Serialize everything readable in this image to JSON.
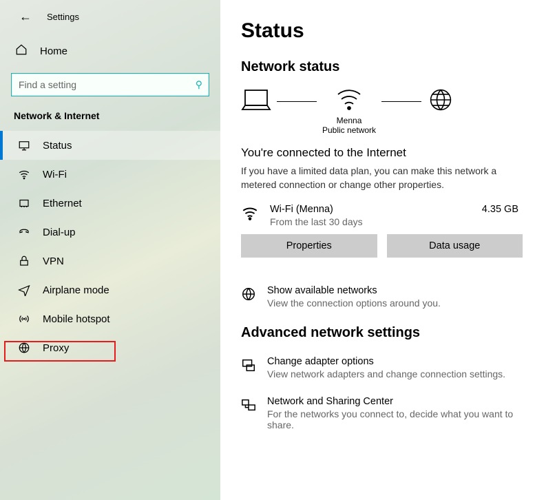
{
  "header": {
    "app_title": "Settings"
  },
  "home": {
    "label": "Home"
  },
  "search": {
    "placeholder": "Find a setting"
  },
  "category": {
    "label": "Network & Internet"
  },
  "nav": {
    "items": [
      {
        "label": "Status"
      },
      {
        "label": "Wi-Fi"
      },
      {
        "label": "Ethernet"
      },
      {
        "label": "Dial-up"
      },
      {
        "label": "VPN"
      },
      {
        "label": "Airplane mode"
      },
      {
        "label": "Mobile hotspot"
      },
      {
        "label": "Proxy"
      }
    ]
  },
  "main": {
    "title": "Status",
    "section_title": "Network status",
    "diagram": {
      "ap_name": "Menna",
      "ap_type": "Public network"
    },
    "connected_title": "You're connected to the Internet",
    "connected_desc": "If you have a limited data plan, you can make this network a metered connection or change other properties.",
    "connection": {
      "name": "Wi-Fi (Menna)",
      "meta": "From the last 30 days",
      "data": "4.35 GB"
    },
    "buttons": {
      "properties": "Properties",
      "usage": "Data usage"
    },
    "avail": {
      "title": "Show available networks",
      "sub": "View the connection options around you."
    },
    "advanced_title": "Advanced network settings",
    "adapter": {
      "title": "Change adapter options",
      "sub": "View network adapters and change connection settings."
    },
    "sharing": {
      "title": "Network and Sharing Center",
      "sub": "For the networks you connect to, decide what you want to share."
    }
  }
}
